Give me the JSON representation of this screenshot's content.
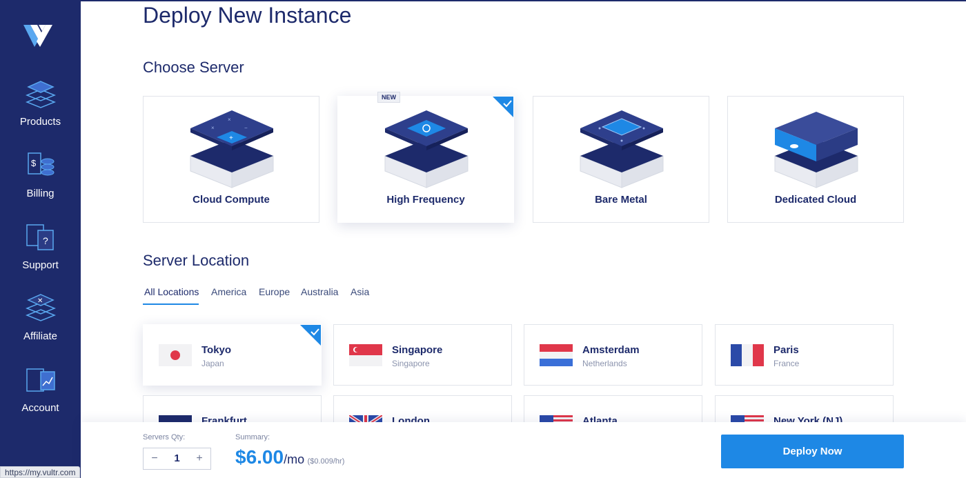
{
  "sidebar": {
    "items": [
      {
        "label": "Products"
      },
      {
        "label": "Billing"
      },
      {
        "label": "Support"
      },
      {
        "label": "Affiliate"
      },
      {
        "label": "Account"
      }
    ]
  },
  "page": {
    "title": "Deploy New Instance",
    "choose_server_title": "Choose Server",
    "server_location_title": "Server Location"
  },
  "servers": [
    {
      "name": "Cloud Compute"
    },
    {
      "name": "High Frequency",
      "badge": "NEW",
      "selected": true
    },
    {
      "name": "Bare Metal"
    },
    {
      "name": "Dedicated Cloud"
    }
  ],
  "location_tabs": [
    "All Locations",
    "America",
    "Europe",
    "Australia",
    "Asia"
  ],
  "locations": [
    {
      "city": "Tokyo",
      "country": "Japan",
      "selected": true
    },
    {
      "city": "Singapore",
      "country": "Singapore"
    },
    {
      "city": "Amsterdam",
      "country": "Netherlands"
    },
    {
      "city": "Paris",
      "country": "France"
    },
    {
      "city": "Frankfurt",
      "country": ""
    },
    {
      "city": "London",
      "country": ""
    },
    {
      "city": "Atlanta",
      "country": ""
    },
    {
      "city": "New York (NJ)",
      "country": ""
    }
  ],
  "footer": {
    "qty_label": "Servers Qty:",
    "qty_minus": "−",
    "qty_value": "1",
    "qty_plus": "+",
    "summary_label": "Summary:",
    "price": "$6.00",
    "price_per": "/mo",
    "price_hourly": "($0.009/hr)",
    "deploy_label": "Deploy Now"
  },
  "status_url": "https://my.vultr.com",
  "colors": {
    "sidebar": "#1d2a6b",
    "accent": "#1e88e5"
  }
}
